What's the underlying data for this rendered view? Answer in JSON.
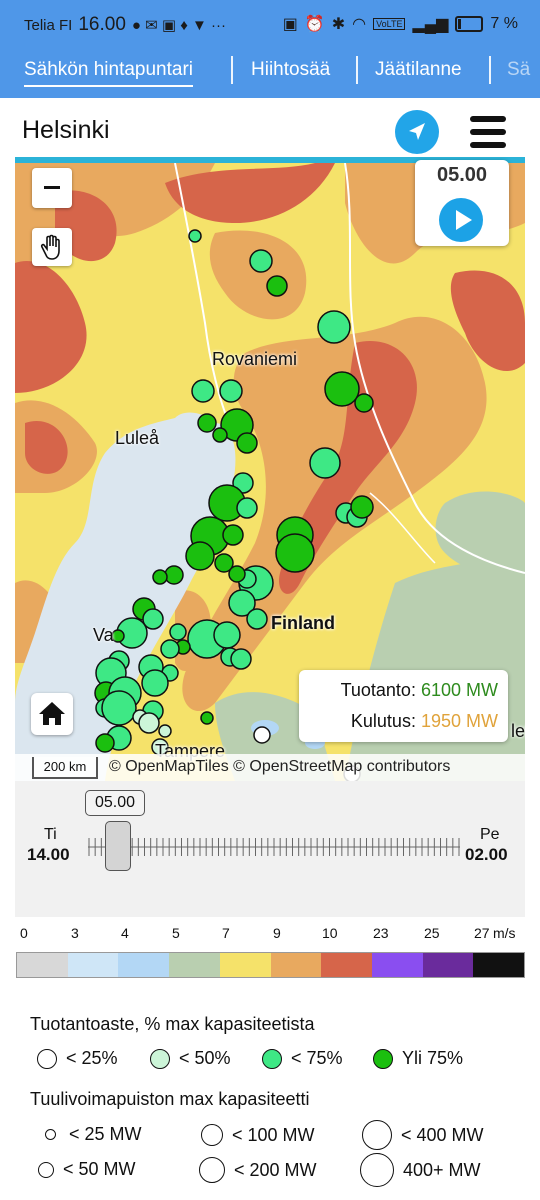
{
  "status_bar": {
    "carrier": "Telia FI",
    "time": "16.00",
    "battery": "7 %",
    "network_badge": "VoLTE"
  },
  "tabs": [
    {
      "label": "Sähkön hintapuntari",
      "active": true
    },
    {
      "label": "Hiihtosää",
      "active": false
    },
    {
      "label": "Jäätilanne",
      "active": false
    },
    {
      "label": "Sä",
      "active": false
    }
  ],
  "header": {
    "city": "Helsinki",
    "locate_icon": "navigation-arrow-icon",
    "menu_icon": "hamburger-menu-icon"
  },
  "map": {
    "time_label": "05.00",
    "play_icon": "play-icon",
    "zoom_out_icon": "minus-icon",
    "pan_icon": "hand-icon",
    "home_icon": "home-icon",
    "place_labels": {
      "rovaniemi": "Rovaniemi",
      "lulea": "Luleå",
      "finland": "Finland",
      "vaasa": "Va",
      "tampere": "Tampere",
      "right_edge": "let"
    },
    "production": {
      "label": "Tuotanto:",
      "value": "6100 MW",
      "color": "#2e8b1e"
    },
    "consumption": {
      "label": "Kulutus:",
      "value": "1950 MW",
      "color": "#e0a33b"
    },
    "scale_label": "200 km",
    "attribution": "© OpenMapTiles © OpenStreetMap contributors"
  },
  "timeline": {
    "current": "05.00",
    "start_day": "Ti",
    "start_hour": "14.00",
    "end_day": "Pe",
    "end_hour": "02.00"
  },
  "wind_scale": {
    "labels": [
      "0",
      "3",
      "4",
      "5",
      "7",
      "9",
      "10",
      "23",
      "25",
      "27"
    ],
    "unit": "m/s",
    "colors": [
      "#d8d8d8",
      "#cfe6f7",
      "#b3d7f5",
      "#b9cfb0",
      "#f5e26a",
      "#e8a95f",
      "#d6654a",
      "#8a4ef0",
      "#6a2b9c",
      "#111111"
    ]
  },
  "legend": {
    "production_title": "Tuotantoaste, % max kapasiteetista",
    "production_levels": [
      {
        "label": "< 25%",
        "color": "#ffffff"
      },
      {
        "label": "< 50%",
        "color": "#ccf5d8"
      },
      {
        "label": "< 75%",
        "color": "#3ee885"
      },
      {
        "label": "Yli 75%",
        "color": "#1bbf0f"
      }
    ],
    "capacity_title": "Tuulivoimapuiston max kapasiteetti",
    "capacity_levels": [
      {
        "label": "< 25 MW"
      },
      {
        "label": "< 100 MW"
      },
      {
        "label": "< 400 MW"
      },
      {
        "label": "< 50 MW"
      },
      {
        "label": "< 200 MW"
      },
      {
        "label": "400+ MW"
      }
    ]
  }
}
